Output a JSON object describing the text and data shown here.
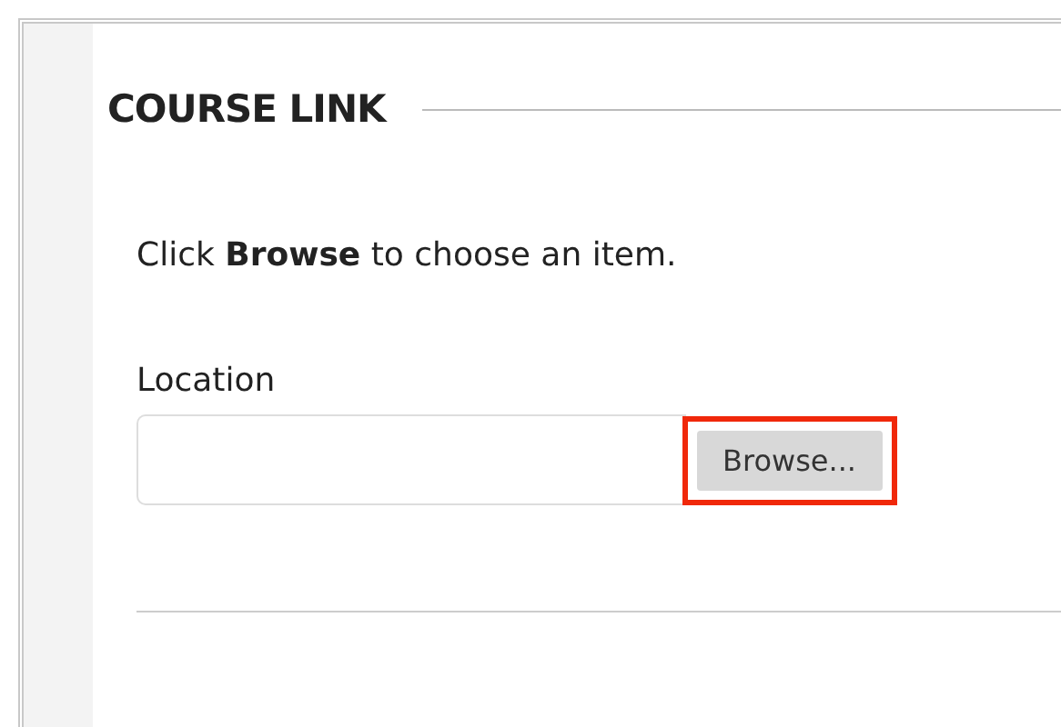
{
  "section": {
    "title": "COURSE LINK"
  },
  "instruction": "Click **Browse** to choose an item.",
  "location": {
    "label": "Location",
    "button": {
      "label": "Browse...",
      "highlighted": true
    }
  }
}
